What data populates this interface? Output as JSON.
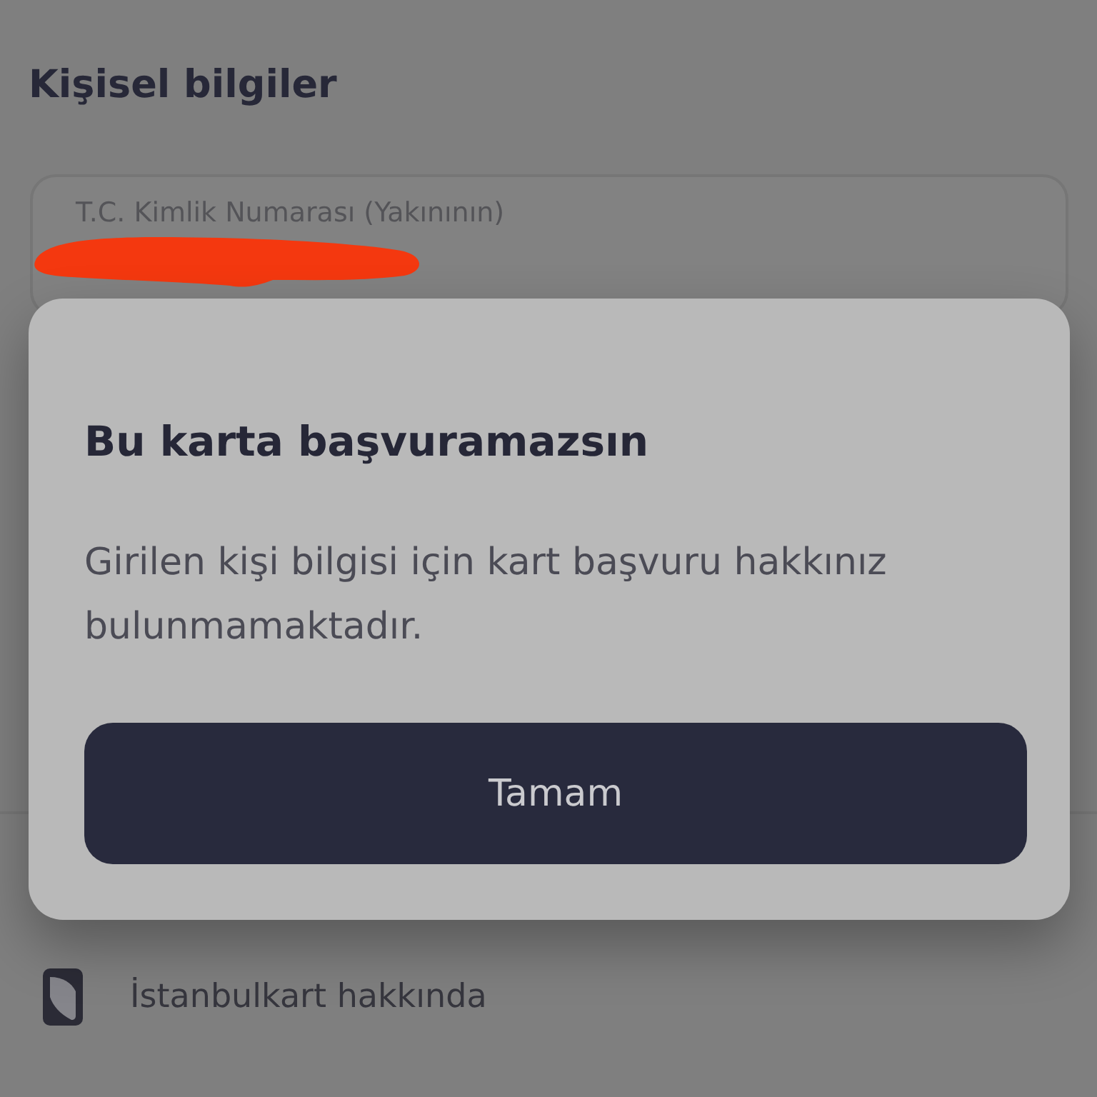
{
  "section": {
    "heading": "Kişisel bilgiler"
  },
  "field": {
    "label": "T.C. Kimlik Numarası (Yakınının)"
  },
  "dialog": {
    "title": "Bu karta başvuramazsın",
    "message": "Girilen kişi bilgisi için kart başvuru hakkınız bulunmamaktadır.",
    "buttons": [
      "Tamam"
    ]
  },
  "menu_items": [
    {
      "label": "İstanbulkart hakkında"
    }
  ]
}
